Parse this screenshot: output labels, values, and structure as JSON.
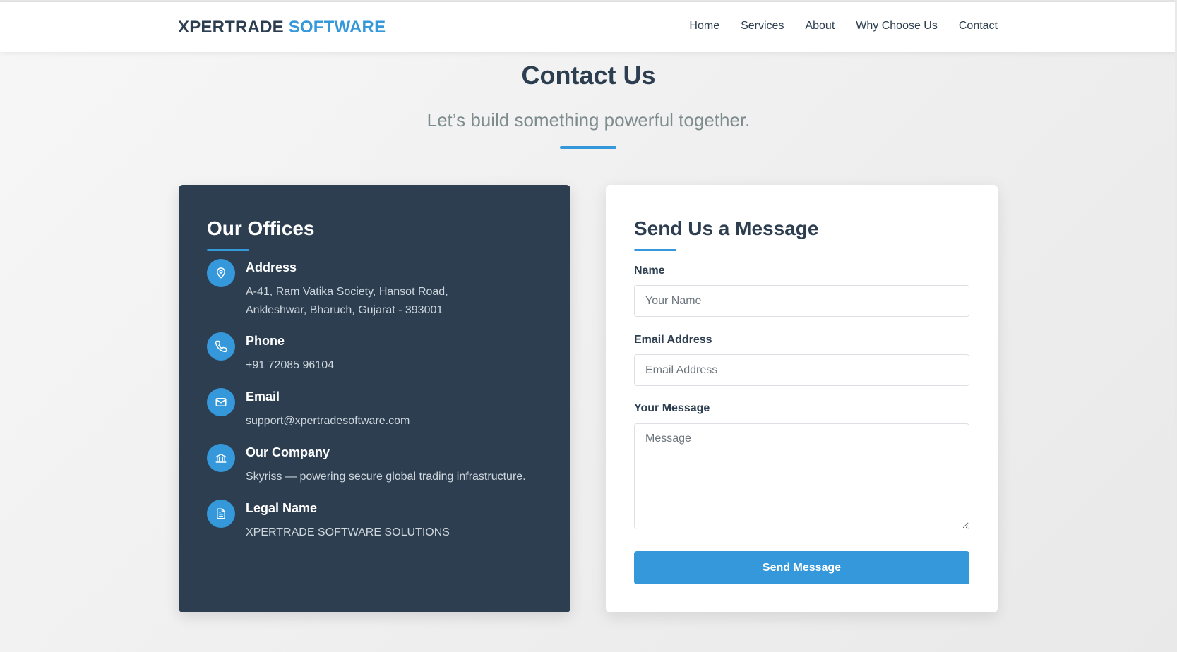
{
  "brand": {
    "part1": "XPERTRADE",
    "part2": "SOFTWARE"
  },
  "nav": {
    "items": [
      {
        "label": "Home"
      },
      {
        "label": "Services"
      },
      {
        "label": "About"
      },
      {
        "label": "Why Choose Us"
      },
      {
        "label": "Contact"
      }
    ]
  },
  "hero": {
    "title": "Contact Us",
    "subtitle": "Let’s build something powerful together."
  },
  "offices": {
    "heading": "Our Offices",
    "items": [
      {
        "icon": "location-pin-icon",
        "label": "Address",
        "lines": [
          "A-41, Ram Vatika Society, Hansot Road,",
          "Ankleshwar, Bharuch, Gujarat - 393001"
        ]
      },
      {
        "icon": "phone-icon",
        "label": "Phone",
        "lines": [
          "+91 72085 96104"
        ]
      },
      {
        "icon": "mail-icon",
        "label": "Email",
        "lines": [
          "support@xpertradesoftware.com"
        ]
      },
      {
        "icon": "bank-building-icon",
        "label": "Our Company",
        "lines": [
          "Skyriss — powering secure global trading infrastructure."
        ]
      },
      {
        "icon": "document-icon",
        "label": "Legal Name",
        "lines": [
          "XPERTRADE SOFTWARE SOLUTIONS"
        ]
      }
    ]
  },
  "form": {
    "heading": "Send Us a Message",
    "name_label": "Name",
    "name_placeholder": "Your Name",
    "email_label": "Email Address",
    "email_placeholder": "Email Address",
    "message_label": "Your Message",
    "message_placeholder": "Message",
    "submit_label": "Send Message"
  },
  "colors": {
    "accent": "#3498db",
    "dark": "#2c3e50",
    "muted": "#7f8c8d"
  }
}
